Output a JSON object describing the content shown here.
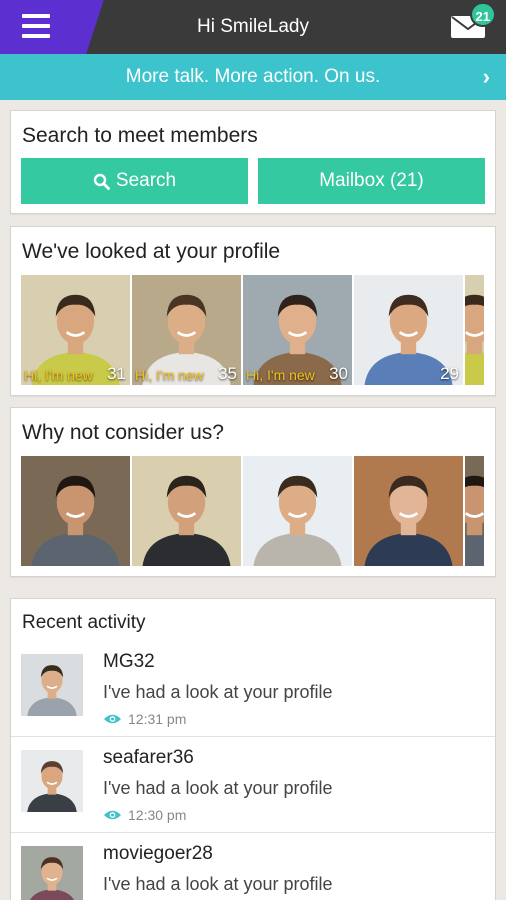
{
  "header": {
    "title": "Hi SmileLady",
    "mail_badge": "21"
  },
  "promo": {
    "text": "More talk. More action. On us.",
    "arrow": "›"
  },
  "search": {
    "title": "Search to meet members",
    "search_label": "Search",
    "mailbox_label": "Mailbox (21)"
  },
  "looked": {
    "title": "We've looked at your profile",
    "profiles": [
      {
        "tag": "Hi, I'm new",
        "age": "31",
        "bg": "#d8cfb0",
        "shirt": "#c9c94a",
        "skin": "#d9a77f",
        "hair": "#3a2a1e"
      },
      {
        "tag": "Hi, I'm new",
        "age": "35",
        "bg": "#b8a98a",
        "shirt": "#e8e6e2",
        "skin": "#dcae88",
        "hair": "#4a3524"
      },
      {
        "tag": "Hi, I'm new",
        "age": "30",
        "bg": "#9fa9b0",
        "shirt": "#8a6a4a",
        "skin": "#e0b08c",
        "hair": "#2e221a"
      },
      {
        "tag": "",
        "age": "29",
        "bg": "#e9ecef",
        "shirt": "#5a7fb8",
        "skin": "#dba882",
        "hair": "#3d2c1f"
      }
    ]
  },
  "consider": {
    "title": "Why not consider us?",
    "profiles": [
      {
        "bg": "#7a6a55",
        "shirt": "#5c6470",
        "skin": "#c99470",
        "hair": "#1e1712"
      },
      {
        "bg": "#d9cfae",
        "shirt": "#2b2d31",
        "skin": "#d2a07a",
        "hair": "#2c241c"
      },
      {
        "bg": "#e8eef2",
        "shirt": "#b9b5ad",
        "skin": "#ddad88",
        "hair": "#3a2b1e"
      },
      {
        "bg": "#b07a4e",
        "shirt": "#2e3b55",
        "skin": "#e2b596",
        "hair": "#3a2a20"
      }
    ]
  },
  "activity": {
    "title": "Recent activity",
    "items": [
      {
        "name": "MG32",
        "message": "I've had a look at your profile",
        "time": "12:31 pm",
        "bg": "#d9dde0",
        "shirt": "#9aa3ab",
        "skin": "#dcae8a",
        "hair": "#3a2b1f"
      },
      {
        "name": "seafarer36",
        "message": "I've had a look at your profile",
        "time": "12:30 pm",
        "bg": "#e8eaec",
        "shirt": "#3a3f46",
        "skin": "#d9a680",
        "hair": "#5a4030"
      },
      {
        "name": "moviegoer28",
        "message": "I've had a look at your profile",
        "time": "",
        "bg": "#a3a8a0",
        "shirt": "#7a4a5a",
        "skin": "#e0b290",
        "hair": "#4a3322"
      }
    ]
  },
  "colors": {
    "accent_green": "#35c9a1",
    "promo_teal": "#3cc3cc",
    "header_purple": "#5b2fd0",
    "header_dark": "#3a3a3a",
    "eye_icon": "#3cc3cc"
  },
  "icons": {
    "menu": "hamburger-icon",
    "mail": "envelope-icon",
    "search": "magnifier-icon",
    "seen": "eye-icon"
  }
}
